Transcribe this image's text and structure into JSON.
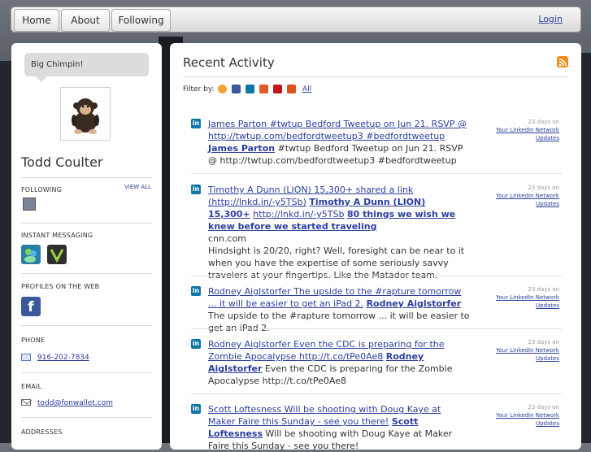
{
  "nav": {
    "home": "Home",
    "about": "About",
    "following": "Following",
    "login": "Login"
  },
  "profile": {
    "status": "Big Chimpin!",
    "name": "Todd Coulter",
    "following_label": "FOLLOWING",
    "view_all": "VIEW ALL",
    "im_label": "INSTANT MESSAGING",
    "web_label": "PROFILES ON THE WEB",
    "phone_label": "PHONE",
    "phone": "916-202-7834",
    "email_label": "EMAIL",
    "email": "todd@fonwallet.com",
    "addresses_label": "ADDRESSES"
  },
  "activity": {
    "title": "Recent Activity",
    "filter_label": "Filter by:",
    "filter_all": "All",
    "items": [
      {
        "headline": "James Parton #twtup Bedford Tweetup on Jun 21. RSVP @ http://twtup.com/bedfordtweetup3 #bedfordtweetup",
        "author": "James Parton",
        "body": "#twtup Bedford Tweetup on Jun 21. RSVP @ http://twtup.com/bedfordtweetup3 #bedfordtweetup",
        "when": "23 days on",
        "source": "Your LinkedIn Network Updates"
      },
      {
        "headline": "Timothy A Dunn (LION) 15,300+ shared a link (http://lnkd.in/-y5TSb)",
        "author": "Timothy A Dunn (LION) 15,300+",
        "link": "http://lnkd.in/-y5TSb",
        "link_title": "80 things we wish we knew before we started traveling",
        "domain": "cnn.com",
        "body": "Hindsight is 20/20, right? Well, foresight can be near to it when you have the expertise of some seriously savvy travelers at your fingertips. Like the Matador team.",
        "when": "23 days on",
        "source": "Your LinkedIn Network Updates"
      },
      {
        "headline": "Rodney Aiglstorfer The upside to the #rapture tomorrow ... it will be easier to get an iPad 2.",
        "author": "Rodney Aiglstorfer",
        "body": "The upside to the #rapture tomorrow ... it will be easier to get an iPad 2.",
        "when": "23 days on",
        "source": "Your LinkedIn Network Updates"
      },
      {
        "headline": "Rodney Aiglstorfer Even the CDC is preparing for the Zombie Apocalypse http://t.co/tPe0Ae8",
        "author": "Rodney Aiglstorfer",
        "body": "Even the CDC is preparing for the Zombie Apocalypse http://t.co/tPe0Ae8",
        "when": "23 days on",
        "source": "Your LinkedIn Network Updates"
      },
      {
        "headline": "Scott Loftesness Will be shooting with Doug Kaye at Maker Faire this Sunday - see you there!",
        "author": "Scott Loftesness",
        "body": "Will be shooting with Doug Kaye at Maker Faire this Sunday - see you there!",
        "when": "23 days on",
        "source": "Your LinkedIn Network Updates"
      }
    ]
  }
}
